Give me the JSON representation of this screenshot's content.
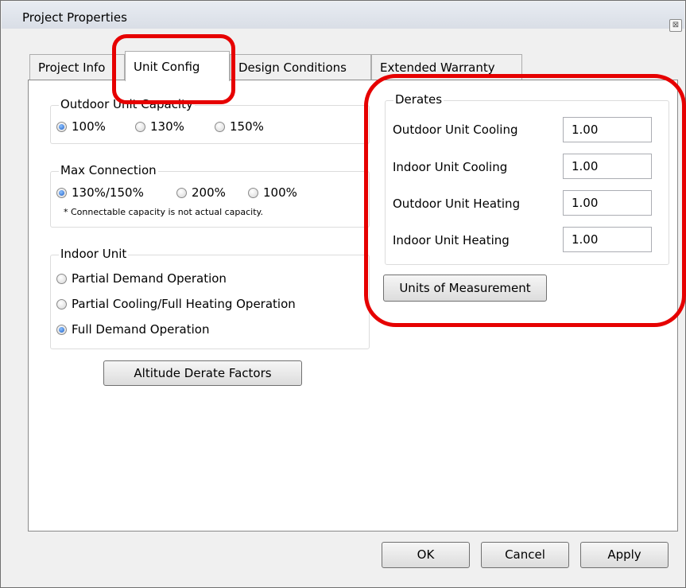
{
  "window": {
    "title": "Project Properties",
    "close_glyph": "⊠"
  },
  "tabs": [
    {
      "label": "Project Info"
    },
    {
      "label": "Unit Config"
    },
    {
      "label": "Design Conditions"
    },
    {
      "label": "Extended Warranty"
    }
  ],
  "outdoor_capacity": {
    "legend": "Outdoor Unit Capacity",
    "options": [
      "100%",
      "130%",
      "150%"
    ],
    "selected": "100%"
  },
  "max_connection": {
    "legend": "Max Connection",
    "options": [
      "130%/150%",
      "200%",
      "100%"
    ],
    "selected": "130%/150%",
    "note": "* Connectable capacity is not actual capacity."
  },
  "indoor_unit": {
    "legend": "Indoor Unit",
    "options": [
      "Partial Demand Operation",
      "Partial Cooling/Full Heating Operation",
      "Full Demand Operation"
    ],
    "selected": "Full Demand Operation"
  },
  "altitude_button": "Altitude Derate Factors",
  "derates": {
    "legend": "Derates",
    "rows": [
      {
        "label": "Outdoor Unit Cooling",
        "value": "1.00"
      },
      {
        "label": "Indoor Unit Cooling",
        "value": "1.00"
      },
      {
        "label": "Outdoor Unit Heating",
        "value": "1.00"
      },
      {
        "label": "Indoor Unit Heating",
        "value": "1.00"
      }
    ]
  },
  "units_button": "Units of Measurement",
  "footer": {
    "ok": "OK",
    "cancel": "Cancel",
    "apply": "Apply"
  },
  "colors": {
    "highlight": "#e60000",
    "radio_selected": "#1e5fc7"
  }
}
